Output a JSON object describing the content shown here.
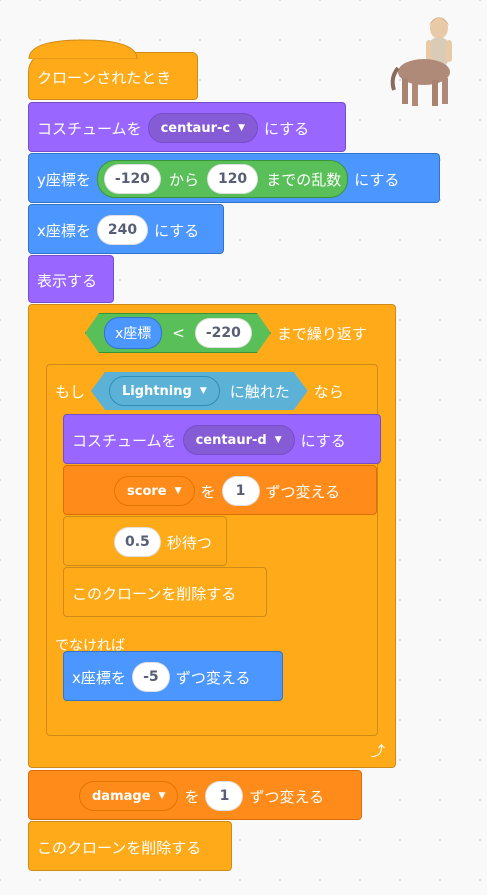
{
  "hat": {
    "label": "クローンされたとき"
  },
  "costume1": {
    "prefix": "コスチュームを",
    "value": "centaur-c",
    "suffix": "にする"
  },
  "sety": {
    "prefix": "y座標を",
    "from": "-120",
    "mid": "から",
    "to": "120",
    "tail": "までの乱数",
    "suffix": "にする"
  },
  "setx": {
    "prefix": "x座標を",
    "value": "240",
    "suffix": "にする"
  },
  "show": {
    "label": "表示する"
  },
  "repeat_until": {
    "reporter": "x座標",
    "op": "<",
    "value": "-220",
    "suffix": "まで繰り返す"
  },
  "if_else": {
    "if_label": "もし",
    "touching": "Lightning",
    "touching_suffix": "に触れた",
    "then": "なら",
    "else_label": "でなければ"
  },
  "costume2": {
    "prefix": "コスチュームを",
    "value": "centaur-d",
    "suffix": "にする"
  },
  "change_score": {
    "var": "score",
    "mid": "を",
    "value": "1",
    "suffix": "ずつ変える"
  },
  "wait": {
    "value": "0.5",
    "suffix": "秒待つ"
  },
  "delete1": {
    "label": "このクローンを削除する"
  },
  "changex": {
    "prefix": "x座標を",
    "value": "-5",
    "suffix": "ずつ変える"
  },
  "change_damage": {
    "var": "damage",
    "mid": "を",
    "value": "1",
    "suffix": "ずつ変える"
  },
  "delete2": {
    "label": "このクローンを削除する"
  },
  "icons": {
    "dropdown": "caret-down-icon",
    "loop": "loop-arrow-icon",
    "sprite": "centaur-sprite-thumbnail"
  },
  "colors": {
    "events": "#ffab19",
    "looks": "#9966ff",
    "motion": "#4c97ff",
    "control": "#ffab19",
    "variables": "#ff8c1a",
    "operators": "#59c059",
    "sensing": "#5cb1d6"
  }
}
